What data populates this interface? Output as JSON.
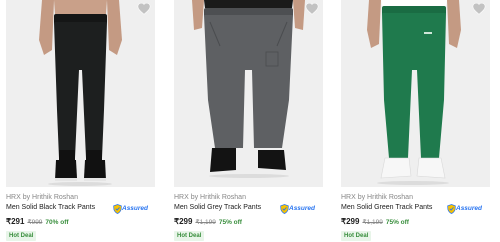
{
  "products": [
    {
      "brand": "HRX by Hrithik Roshan",
      "title": "Men Solid Black Track Pants",
      "price": "₹291",
      "mrp": "₹999",
      "discount": "70% off",
      "assured": "Assured",
      "deal": "Hot Deal",
      "pant_color": "#1d1f1f",
      "icon": "heart-icon"
    },
    {
      "brand": "HRX by Hrithik Roshan",
      "title": "Men Solid Grey Track Pants",
      "price": "₹299",
      "mrp": "₹1,199",
      "discount": "75% off",
      "assured": "Assured",
      "deal": "Hot Deal",
      "pant_color": "#5e6063",
      "icon": "heart-icon"
    },
    {
      "brand": "HRX by Hrithik Roshan",
      "title": "Men Solid Green Track Pants",
      "price": "₹299",
      "mrp": "₹1,199",
      "discount": "75% off",
      "assured": "Assured",
      "deal": "Hot Deal",
      "pant_color": "#1f7a4d",
      "icon": "heart-icon"
    }
  ],
  "colors": {
    "accent_blue": "#2874f0",
    "discount_green": "#388e3c",
    "deal_bg": "#e8f5e9",
    "image_bg": "#f1f1f1"
  }
}
